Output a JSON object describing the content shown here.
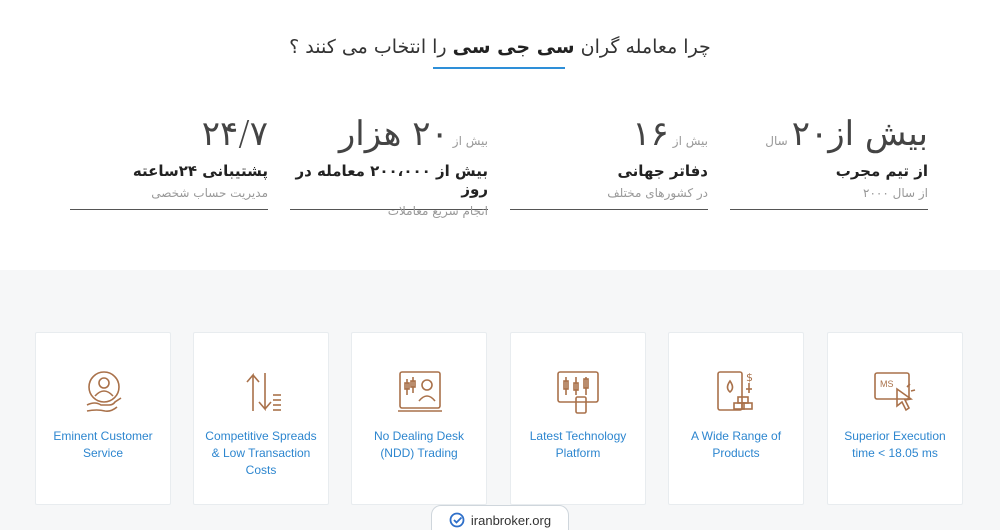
{
  "heading": {
    "part1": "چرا معامله گران ",
    "brand": "سی جی سی",
    "part2": " را انتخاب می کنند ؟"
  },
  "stats": [
    {
      "small": "سال",
      "big": "بیش از۲۰",
      "title": "از تیم مجرب",
      "sub": "از سال ۲۰۰۰"
    },
    {
      "small": "بیش از",
      "big": "۱۶",
      "title": "دفاتر جهانی",
      "sub": "در کشورهای مختلف"
    },
    {
      "small": "بیش از",
      "big": "۲۰ هزار",
      "title": "بیش از ۲۰۰،۰۰۰ معامله در روز",
      "sub": "انجام سریع معاملات"
    },
    {
      "small": "",
      "big": "۲۴/۷",
      "title": "پشتیبانی ۲۴ساعته",
      "sub": "مدیریت حساب شخصی"
    }
  ],
  "cards": [
    {
      "label": "Eminent Customer Service",
      "icon": "customer-service-icon"
    },
    {
      "label": "Competitive Spreads & Low Transaction Costs",
      "icon": "spread-arrows-icon"
    },
    {
      "label": "No Dealing Desk (NDD) Trading",
      "icon": "dealing-desk-icon"
    },
    {
      "label": "Latest Technology Platform",
      "icon": "trading-platform-icon"
    },
    {
      "label": "A Wide Range of Products",
      "icon": "products-icon"
    },
    {
      "label": "Superior Execution time < 18.05 ms",
      "icon": "execution-cursor-icon"
    }
  ],
  "watermark": {
    "text": "iranbroker.org",
    "icon": "check-circle-icon"
  },
  "colors": {
    "accent": "#2e8fd8",
    "icon": "#a9714a",
    "cardText": "#2d86cf"
  }
}
